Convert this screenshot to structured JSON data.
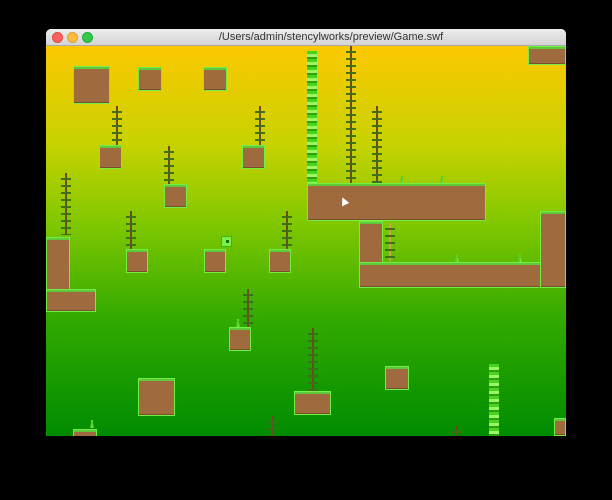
{
  "window": {
    "title": "/Users/admin/stencylworks/preview/Game.swf"
  },
  "colors": {
    "sky_top": "#fcc800",
    "ground_bottom": "#008c00",
    "dirt": "#9e6a3e",
    "grass_edge": "#73ee45",
    "player": "#7bf04a"
  }
}
